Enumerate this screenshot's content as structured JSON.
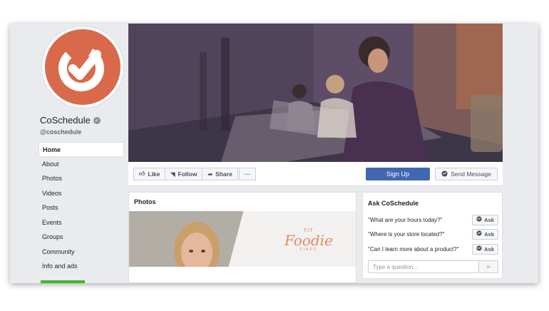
{
  "page": {
    "name": "CoSchedule",
    "handle": "@coschedule"
  },
  "nav": {
    "items": [
      {
        "label": "Home",
        "active": true
      },
      {
        "label": "About",
        "active": false
      },
      {
        "label": "Photos",
        "active": false
      },
      {
        "label": "Videos",
        "active": false
      },
      {
        "label": "Posts",
        "active": false
      },
      {
        "label": "Events",
        "active": false
      },
      {
        "label": "Groups",
        "active": false
      },
      {
        "label": "Community",
        "active": false
      },
      {
        "label": "Info and ads",
        "active": false
      }
    ]
  },
  "actions": {
    "like": "Like",
    "follow": "Follow",
    "share": "Share",
    "more": "···",
    "signup": "Sign Up",
    "send_message": "Send Message"
  },
  "photos": {
    "title": "Photos",
    "brand_top": "FIT",
    "brand_main": "Foodie",
    "brand_sub": "FINDS"
  },
  "ask": {
    "title": "Ask CoSchedule",
    "questions": [
      {
        "text": "\"What are your hours today?\"",
        "button": "Ask"
      },
      {
        "text": "\"Where is your store located?\"",
        "button": "Ask"
      },
      {
        "text": "\"Can I learn more about a product?\"",
        "button": "Ask"
      }
    ],
    "input_placeholder": "Type a question..."
  },
  "colors": {
    "brand_orange": "#d9694b",
    "facebook_blue": "#4267b2",
    "background": "#e9ebee"
  }
}
